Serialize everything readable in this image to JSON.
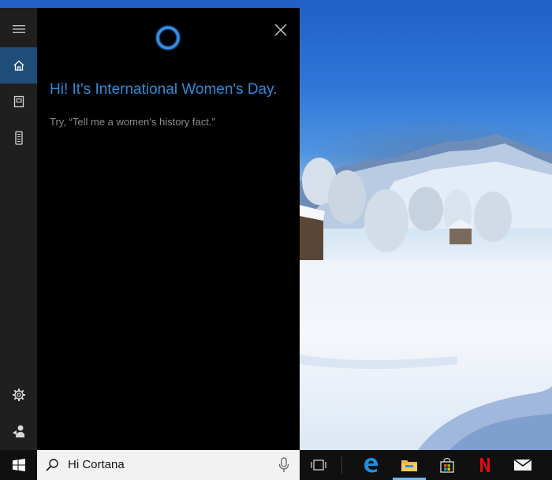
{
  "cortana": {
    "greeting": "Hi! It's International Women's Day.",
    "hint": "Try, “Tell me a women's history fact.”"
  },
  "rail": {
    "items": [
      {
        "icon": "hamburger-menu-icon"
      },
      {
        "icon": "home-icon",
        "active": true
      },
      {
        "icon": "notebook-icon"
      },
      {
        "icon": "devices-icon"
      },
      {
        "icon": "settings-gear-icon"
      },
      {
        "icon": "feedback-icon"
      }
    ]
  },
  "taskbar": {
    "search_text": "Hi Cortana",
    "apps": [
      {
        "icon": "task-view-icon"
      },
      {
        "icon": "edge-icon"
      },
      {
        "icon": "file-explorer-icon",
        "active": true
      },
      {
        "icon": "store-icon"
      },
      {
        "icon": "netflix-icon",
        "label": "N"
      },
      {
        "icon": "mail-icon"
      }
    ]
  },
  "colors": {
    "accent": "#2f8ad8",
    "cortana_ring": "#3a8fe0",
    "rail_active": "#1e4d79",
    "netflix": "#e50914"
  }
}
